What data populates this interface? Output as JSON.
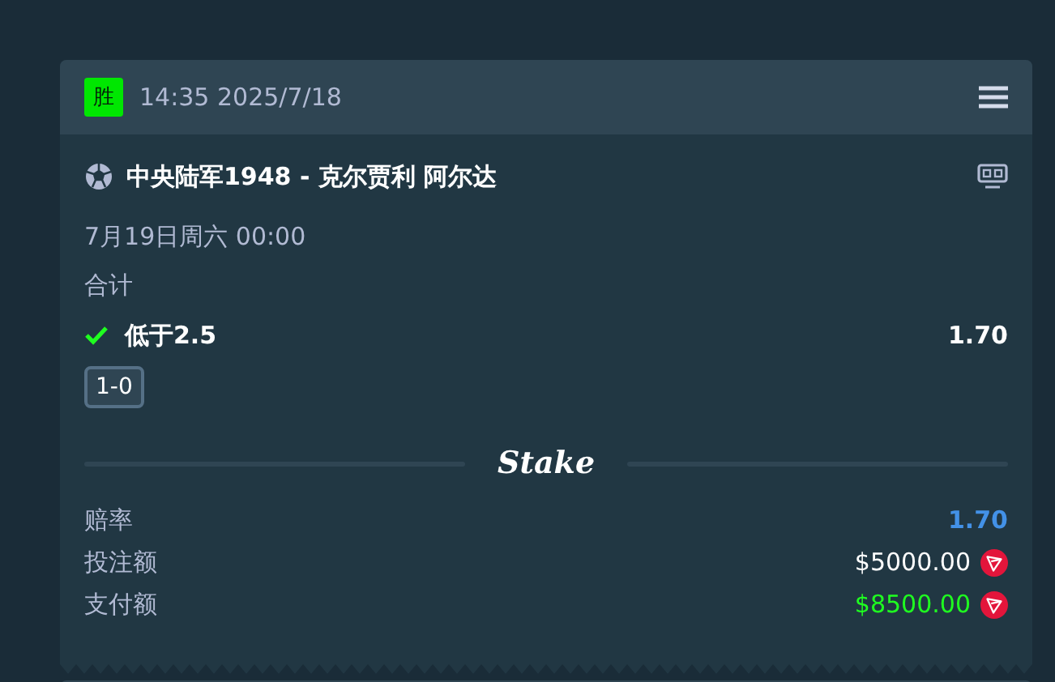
{
  "header": {
    "result_badge": "胜",
    "time": "14:35 2025/7/18"
  },
  "event": {
    "title": "中央陆军1948 - 克尔贾利 阿尔达",
    "date": "7月19日周六 00:00",
    "market": "合计"
  },
  "selection": {
    "name": "低于2.5",
    "won": true,
    "odds": "1.70",
    "score": "1-0"
  },
  "brand": "Stake",
  "summary": [
    {
      "label": "赔率",
      "value": "1.70",
      "color": "#4391e7",
      "coin": false
    },
    {
      "label": "投注额",
      "value": "$5000.00",
      "color": "#ffffff",
      "coin": true
    },
    {
      "label": "支付额",
      "value": "$8500.00",
      "color": "#1fff20",
      "coin": true
    }
  ]
}
